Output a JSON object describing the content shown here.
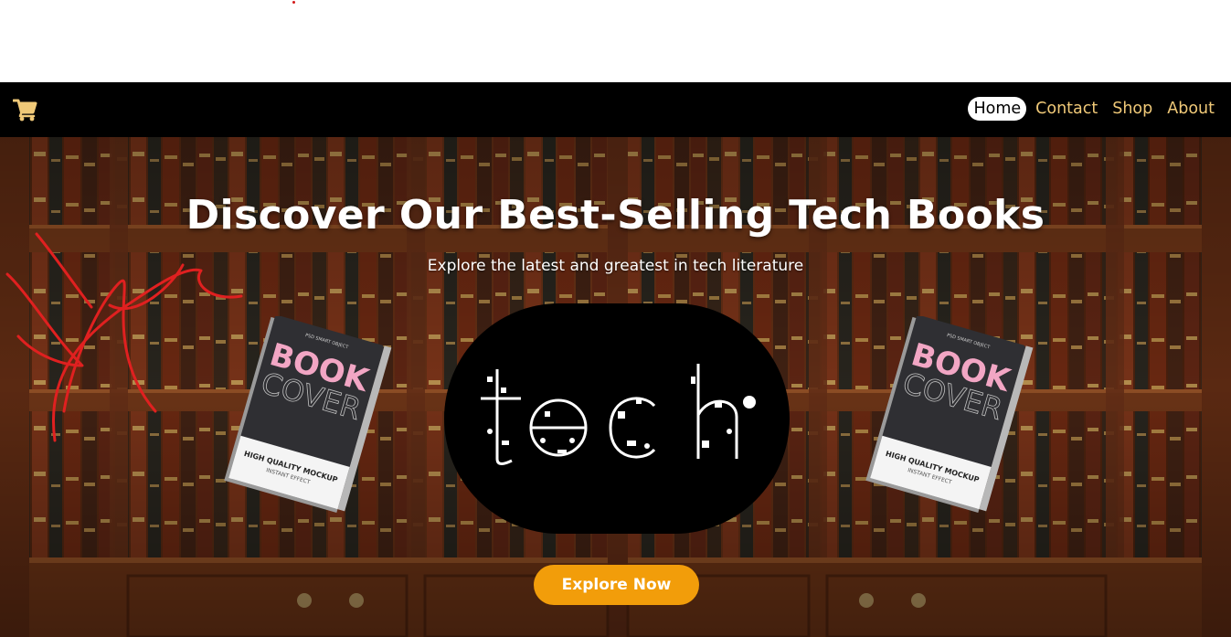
{
  "nav": {
    "links": [
      {
        "label": "Home",
        "active": true
      },
      {
        "label": "Contact",
        "active": false
      },
      {
        "label": "Shop",
        "active": false
      },
      {
        "label": "About",
        "active": false
      }
    ],
    "cart_icon": "shopping-cart-icon"
  },
  "hero": {
    "title": "Discover Our Best-Selling Tech Books",
    "subtitle": "Explore the latest and greatest in tech literature",
    "cta_label": "Explore Now",
    "tech_logo_text": "tech",
    "book_cover": {
      "small_label": "PSD SMART OBJECT",
      "title_line1": "BOOK",
      "title_line2": "COVER",
      "footer_line1": "HIGH QUALITY MOCKUP",
      "footer_line2": "INSTANT EFFECT"
    }
  },
  "colors": {
    "nav_bg": "#000000",
    "nav_link": "#f0c978",
    "cta_bg": "#f29d0a",
    "hero_text": "#ffffff",
    "book_pink": "#f2a6c4",
    "scribble": "#e02020"
  }
}
